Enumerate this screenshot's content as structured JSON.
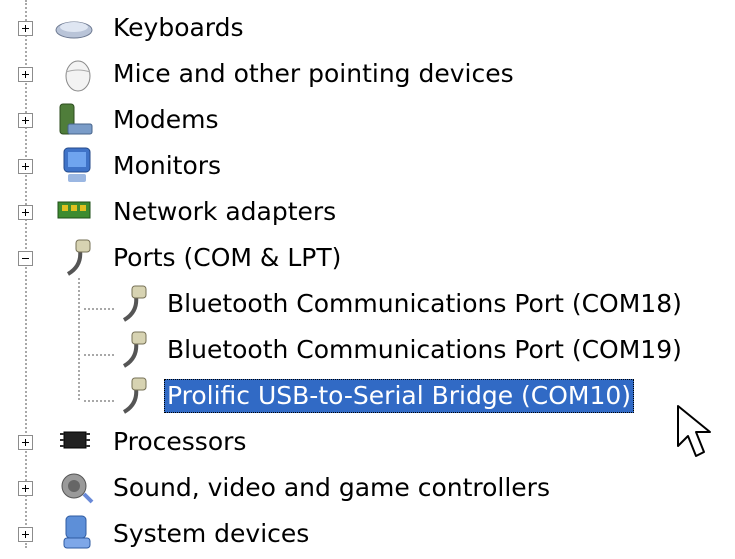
{
  "device_tree": {
    "items": [
      {
        "label": "Keyboards",
        "icon": "keyboard-icon",
        "expander": "plus"
      },
      {
        "label": "Mice and other pointing devices",
        "icon": "mouse-icon",
        "expander": "plus"
      },
      {
        "label": "Modems",
        "icon": "modem-icon",
        "expander": "plus"
      },
      {
        "label": "Monitors",
        "icon": "monitor-icon",
        "expander": "plus"
      },
      {
        "label": "Network adapters",
        "icon": "network-adapter-icon",
        "expander": "plus"
      },
      {
        "label": "Ports (COM & LPT)",
        "icon": "port-icon",
        "expander": "minus"
      },
      {
        "label": "Bluetooth Communications Port (COM18)",
        "icon": "port-icon"
      },
      {
        "label": "Bluetooth Communications Port (COM19)",
        "icon": "port-icon"
      },
      {
        "label": "Prolific USB-to-Serial Bridge (COM10)",
        "icon": "port-icon",
        "selected": true
      },
      {
        "label": "Processors",
        "icon": "processor-icon",
        "expander": "plus"
      },
      {
        "label": "Sound, video and game controllers",
        "icon": "sound-icon",
        "expander": "plus"
      },
      {
        "label": "System devices",
        "icon": "system-devices-icon",
        "expander": "plus"
      }
    ]
  },
  "colors": {
    "selection_background": "#316ac5",
    "selection_text": "#ffffff",
    "tree_lines": "#a8a8a8"
  },
  "cursor": {
    "icon": "mouse-pointer-icon"
  }
}
